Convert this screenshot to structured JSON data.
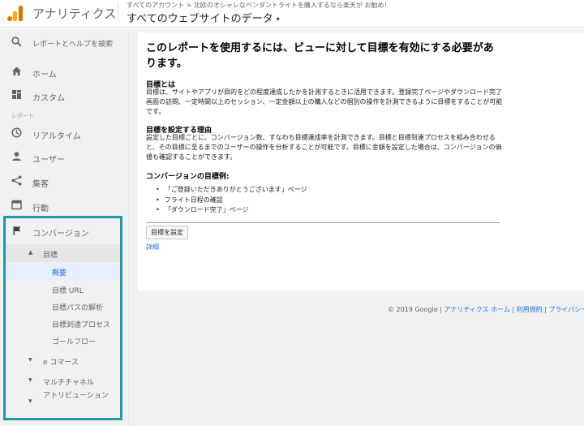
{
  "header": {
    "app_title": "アナリティクス",
    "breadcrumb": "すべてのアカウント > 北欧のオシャレなペンダントライトを購入するなら楽天が お勧め！",
    "view_name": "すべてのウェブサイトのデータ",
    "caret": "▾"
  },
  "sidebar": {
    "search_label": "レポートとヘルプを検索",
    "home": "ホーム",
    "custom": "カスタム",
    "section_reports": "レポート",
    "realtime": "リアルタイム",
    "audience": "ユーザー",
    "acquisition": "集客",
    "behavior": "行動",
    "conversion": "コンバージョン",
    "goals": "目標",
    "goals_items": [
      "概要",
      "目標 URL",
      "目標パスの解析",
      "目標到達プロセス",
      "ゴールフロー"
    ],
    "ecommerce": "e コマース",
    "multichannel": "マルチチャネル",
    "attribution": "アトリビューション"
  },
  "main": {
    "title": "このレポートを使用するには、ビューに対して目標を有効にする必要があります。",
    "what_heading": "目標とは",
    "what_text": "目標は、サイトやアプリが目的をどの程度達成したかを計測するときに活用できます。登録完了ページやダウンロード完了画面の訪問、一定時間以上のセッション、一定金額以上の購入などの個別の操作を計測できるように目標をすることが可能です。",
    "why_heading": "目標を設定する理由",
    "why_text": "設定した目標ごとに、コンバージョン数、すなわち目標達成率を計測できます。目標と目標到達プロセスを組み合わせると、その目標に至るまでのユーザーの操作を分析することが可能です。目標に金額を設定した場合は、コンバージョンの価値も確認することができます。",
    "examples_heading": "コンバージョンの目標例:",
    "examples": [
      "「ご登録いただきありがとうございます」ページ",
      "フライト日程の確認",
      "「ダウンロード完了」ページ"
    ],
    "set_goal_button": "目標を設定",
    "details_link": "詳細"
  },
  "footer": {
    "copyright": "© 2019 Google",
    "sep1": " | ",
    "home_link": "アナリティクス ホーム",
    "sep2": " | ",
    "terms_link": "利用規約",
    "sep3": " | ",
    "privacy_link": "プライバシー"
  },
  "colors": {
    "highlight_box": "#1d9aa6",
    "link": "#1a73e8",
    "logo_orange": "#e37400",
    "logo_yellow": "#f9ab00"
  }
}
